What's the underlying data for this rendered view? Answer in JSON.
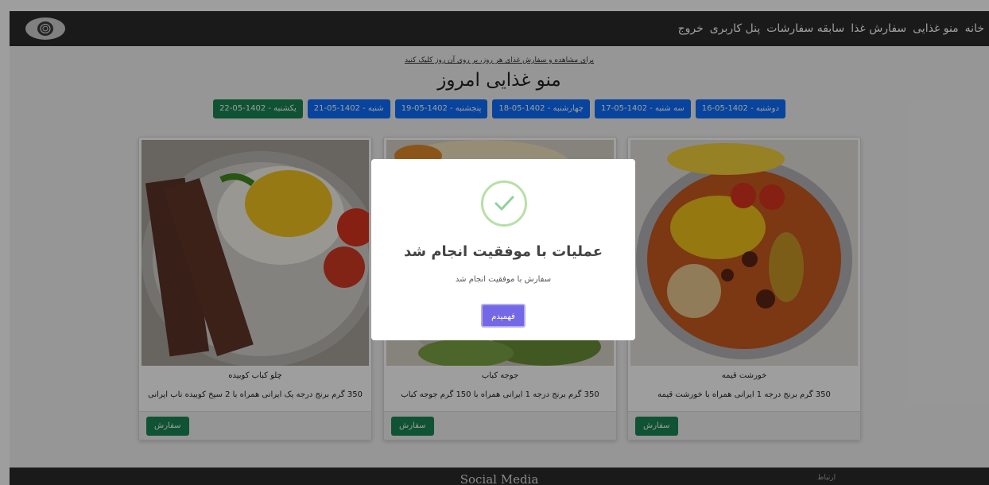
{
  "navbar": {
    "links": [
      "خانه",
      "منو غذایی",
      "سفارش غذا",
      "سابقه سفارشات",
      "پنل کاربری",
      "خروج"
    ]
  },
  "hint": "برای مشاهده و سفارش غذای هر روز، بر روی آن روز کلیک کنید",
  "page_title": "منو غذایی امروز",
  "days": [
    {
      "label": "دوشنبه - 1402-05-16",
      "active": false
    },
    {
      "label": "سه شنبه - 1402-05-17",
      "active": false
    },
    {
      "label": "چهارشنبه - 1402-05-18",
      "active": false
    },
    {
      "label": "پنجشنبه - 1402-05-19",
      "active": false
    },
    {
      "label": "شنبه - 1402-05-21",
      "active": false
    },
    {
      "label": "یکشنبه - 1402-05-22",
      "active": true
    }
  ],
  "cards": [
    {
      "name": "خورشت قیمه",
      "description": "350 گرم برنج درجه 1 ایرانی همراه با خورشت قیمه",
      "order_label": "سفارش"
    },
    {
      "name": "جوجه کباب",
      "description": "350 گرم برنج درجه 1 ایرانی همراه با 150 گرم جوجه کباب",
      "order_label": "سفارش"
    },
    {
      "name": "چلو کباب کوبیده",
      "description": "350 گرم برنج درجه یک ایرانی همراه با 2 سیخ کوبیده ناب ایرانی",
      "order_label": "سفارش"
    }
  ],
  "footer": {
    "social": "Social Media",
    "contact": "ارتباط"
  },
  "modal": {
    "title": "عملیات با موفقیت انجام شد",
    "text": "سفارش با موفقیت انجام شد",
    "button": "فهمیدم"
  },
  "colors": {
    "navbar": "#2a2a2a",
    "day_button": "#0d6efd",
    "day_button_active": "#198754",
    "order_button": "#198754",
    "modal_button": "#7468e6",
    "success": "#8fd19e"
  }
}
